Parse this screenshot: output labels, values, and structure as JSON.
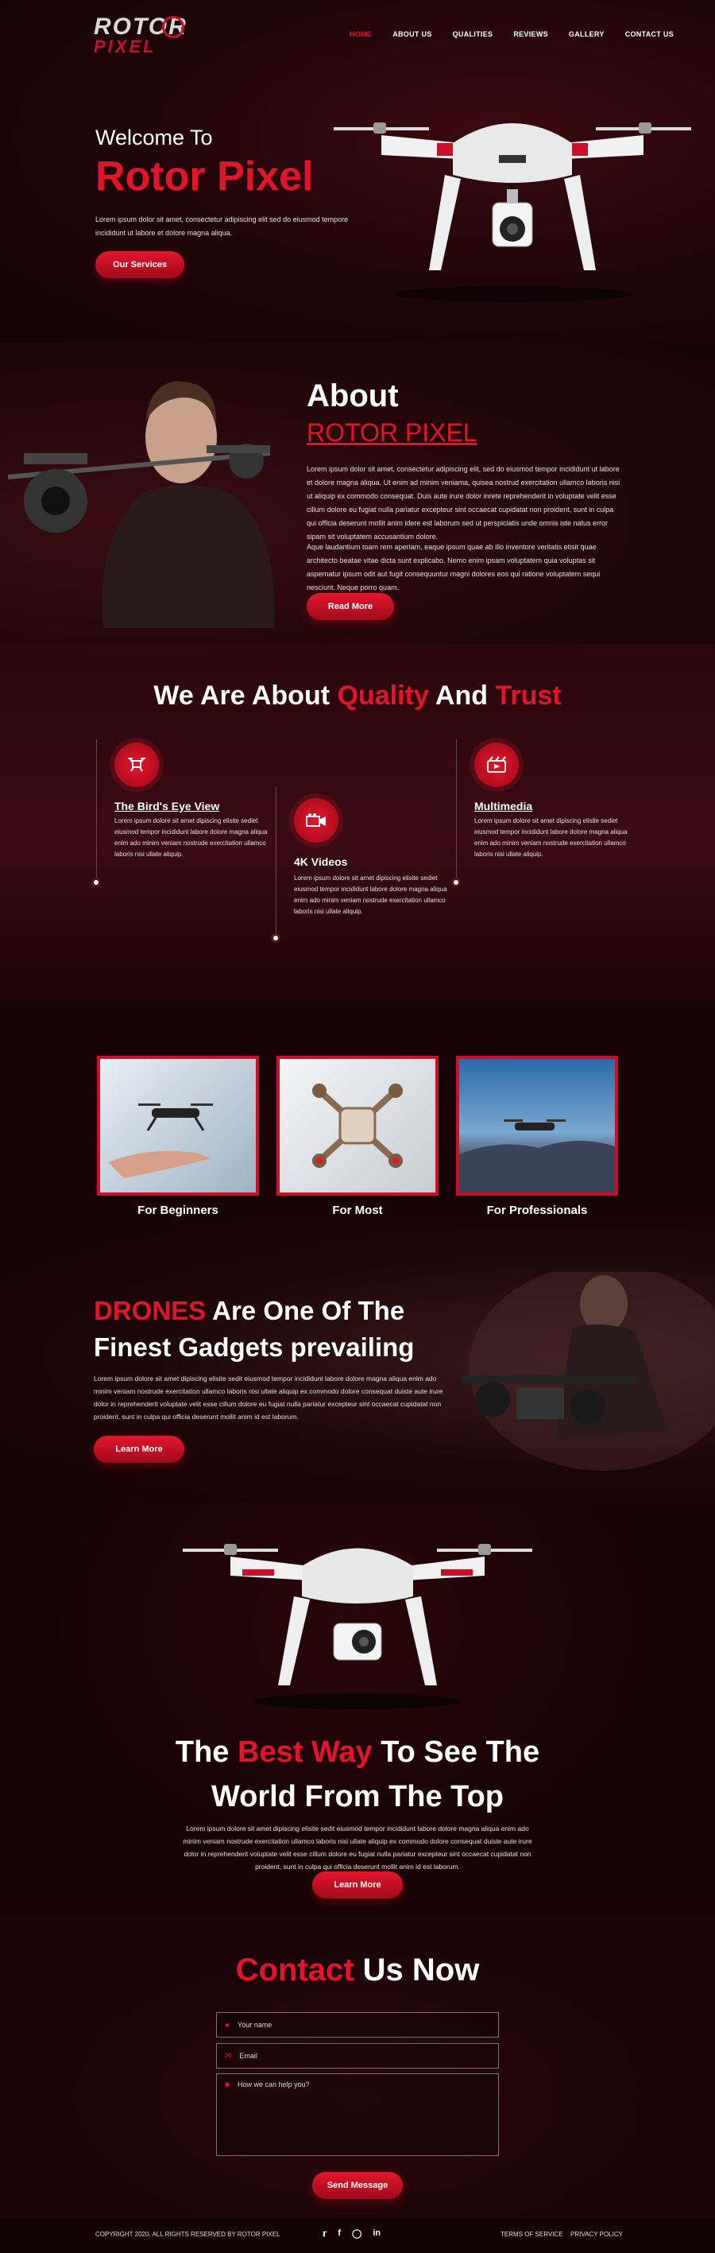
{
  "header": {
    "logo_top": "ROTOR",
    "logo_bottom": "PIXEL",
    "nav": [
      "HOME",
      "ABOUT US",
      "QUALITIES",
      "REVIEWS",
      "GALLERY",
      "CONTACT US"
    ],
    "active_nav": "HOME"
  },
  "hero": {
    "welcome": "Welcome To",
    "brand": "Rotor Pixel",
    "text": "Lorem ipsum dolor sit amet, consectetur adipiscing elit sed do eiusmod tempore incididunt ut labore et dolore magna aliqua.",
    "button": "Our Services"
  },
  "about": {
    "title": "About",
    "subtitle": "ROTOR PIXEL",
    "para1": "Lorem ipsum dolor sit amet, consectetur adipiscing elit, sed do eiusmod tempor incididunt ut labore et dolore magna aliqua. Ut enim ad minim veniama, quisea nostrud exercitation ullamco laboris nisi ut aliquip ex commodo consequat. Duis aute irure dolor inrete reprehenderit in voluptate velit esse cillum dolore eu fugiat nulla pariatur excepteur sint occaecat cupidatat non proident, sunt in culpa qui officia deserunt mollit anim idere est laborum sed ut perspiciatis unde omnis iste natus error sipam sit voluptatem accusantium dolore.",
    "para2": "Aque laudantium toam rem aperiam, eaque ipsum quae ab illo inventore veritatis etisit quae architecto beatae vitae dicta sunt explicabo. Nemo enim ipsam voluptatem quia voluptas sit aspernatur ipsum odit aut fugit consequuntur magni dolores eos qui ratione voluptatem sequi nesciunt. Neque porro quam.",
    "button": "Read More"
  },
  "quality": {
    "title_1": "We Are About ",
    "title_2": "Quality",
    "title_3": " And ",
    "title_4": "Trust",
    "features": [
      {
        "title": "The Bird's Eye View",
        "text": "Lorem ipsum dolore sit amet dipiscing elisite sediet eiusmod tempor incididunt labore dolore magna aliqua enim ado minim veniam nostrude exercitation ullamco laboris nisi ullate aliquip."
      },
      {
        "title": "4K Videos",
        "text": "Lorem ipsum dolore sit amet dipiscing elisite sediet eiusmod tempor incididunt labore dolore magna aliqua enim ado minim veniam nostrude exercitation ullamco laboris nisi ullate aliquip."
      },
      {
        "title": "Multimedia",
        "text": "Lorem ipsum dolore sit amet dipiscing elisite sediet eiusmod tempor incididunt labore dolore magna aliqua enim ado minim veniam nostrude exercitation ullamco laboris nisi ullate aliquip."
      }
    ]
  },
  "gallery": {
    "cards": [
      "For Beginners",
      "For Most",
      "For Professionals"
    ]
  },
  "drones": {
    "title_red": "DRONES",
    "title_rest": " Are One Of The",
    "title_line2": "Finest Gadgets prevailing",
    "text": "Lorem ipsum dolore sit amet dipiscing elisite sedit eiusmod tempor incididunt labore dolore magna aliqua enim ado minim veniam nostrude exercitation ullamco laboris nisi ullate aliquip ex commodo dolore consequat duiste aute irure dolor in reprehenderit voluptate velit esse cillum dolore eu fugiat nulla pariatur excepteur sint occaecat cupidatat non proident, sunt in culpa qui officia deserunt mollit anim id est laborum.",
    "button": "Learn More"
  },
  "best": {
    "t1": "The ",
    "t2": "Best Way",
    "t3": " To See The",
    "line2": "World From The Top",
    "text": "Lorem ipsum dolore sit amet dipiscing elisite sedit eiusmod tempor incididunt labore dolore magna aliqua enim ado minim veniam nostrude exercitation ullamco laboris nisi ullate aliquip ex commodo dolore consequat duiste aute irure dolor in reprehenderit voluptate velit esse cillum dolore eu fugiat nulla pariatur excepteur sint occaecat cupidatat non proident, sunt in culpa qui officia deserunt mollit anim id est laborum.",
    "button": "Learn More"
  },
  "contact": {
    "title_red": "Contact",
    "title_rest": " Us Now",
    "name_placeholder": "Your name",
    "email_placeholder": "Email",
    "message_placeholder": "How we can help you?",
    "button": "Send Message"
  },
  "footer": {
    "copyright": "COPYRIGHT 2020. ALL RIGHTS RESERVED BY ROTOR PIXEL",
    "social": [
      "twitter-icon",
      "facebook-icon",
      "instagram-icon",
      "linkedin-icon"
    ],
    "terms": "TERMS OF SERVICE",
    "privacy": "PRIVACY POLICY"
  },
  "colors": {
    "accent": "#e0142a",
    "background": "#1a0407"
  }
}
